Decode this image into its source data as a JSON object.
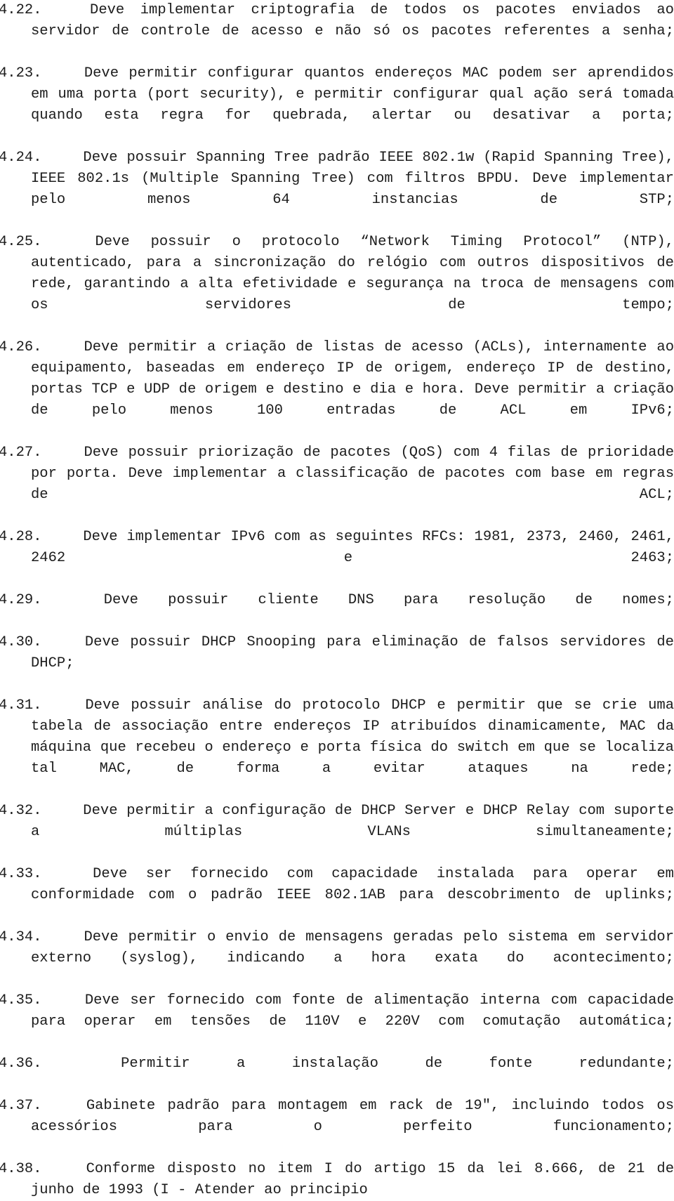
{
  "document": {
    "kind": "specification-list",
    "language": "pt-BR",
    "background_color": "#ffffff",
    "text_color": "#1c1c1c",
    "alignment": "justified",
    "items": [
      {
        "number": "4.22.",
        "text": "Deve implementar criptografia de todos os pacotes enviados ao servidor de controle de acesso e não só os pacotes referentes a senha;",
        "justify_last_line": false
      },
      {
        "number": "4.23.",
        "text": "Deve permitir configurar quantos endereços MAC podem ser aprendidos em uma porta (port security), e permitir configurar qual ação será tomada quando esta regra for quebrada, alertar ou desativar a porta;",
        "justify_last_line": false
      },
      {
        "number": "4.24.",
        "text": "Deve possuir Spanning Tree padrão IEEE 802.1w (Rapid Spanning Tree), IEEE 802.1s (Multiple Spanning Tree) com filtros BPDU. Deve implementar pelo menos 64 instancias de STP;",
        "justify_last_line": false
      },
      {
        "number": "4.25.",
        "text": "Deve possuir o protocolo “Network Timing Protocol” (NTP), autenticado, para a sincronização do relógio com outros dispositivos de rede, garantindo a alta efetividade e segurança na troca de mensagens com os servidores de tempo;",
        "justify_last_line": false
      },
      {
        "number": "4.26.",
        "text": "Deve permitir a criação de listas de acesso (ACLs), internamente ao equipamento, baseadas em endereço IP de origem, endereço IP de destino, portas TCP e UDP de origem e destino e dia e hora. Deve permitir a criação de pelo menos 100 entradas de ACL em IPv6;",
        "justify_last_line": false
      },
      {
        "number": "4.27.",
        "text": "Deve possuir priorização de pacotes (QoS) com 4 filas de prioridade por porta. Deve implementar a classificação de pacotes com base em regras de ACL;",
        "justify_last_line": false
      },
      {
        "number": "4.28.",
        "text": "Deve implementar IPv6 com as seguintes RFCs: 1981, 2373, 2460, 2461, 2462 e 2463;",
        "justify_last_line": false
      },
      {
        "number": "4.29.",
        "text": "Deve possuir cliente DNS para resolução de nomes;",
        "justify_last_line": false
      },
      {
        "number": "4.30.",
        "text": "Deve possuir DHCP Snooping para eliminação de falsos servidores de DHCP;",
        "justify_last_line": false
      },
      {
        "number": "4.31.",
        "text": "Deve possuir análise do protocolo DHCP e permitir que se crie uma tabela de associação entre endereços IP atribuídos dinamicamente, MAC da máquina que recebeu o endereço e porta física do switch em que se localiza tal MAC, de forma a evitar ataques na rede;",
        "justify_last_line": false
      },
      {
        "number": "4.32.",
        "text": "Deve permitir a configuração de DHCP Server e DHCP Relay com suporte a múltiplas VLANs simultaneamente;",
        "justify_last_line": false
      },
      {
        "number": "4.33.",
        "text": "Deve ser fornecido com capacidade instalada para operar em conformidade com o padrão IEEE 802.1AB para descobrimento de uplinks;",
        "justify_last_line": false
      },
      {
        "number": "4.34.",
        "text": "Deve permitir o envio de mensagens geradas pelo sistema em servidor externo (syslog), indicando a hora exata do acontecimento;",
        "justify_last_line": false
      },
      {
        "number": "4.35.",
        "text": "Deve ser fornecido com fonte de alimentação interna com capacidade para operar em tensões de 110V e 220V com comutação automática;",
        "justify_last_line": false
      },
      {
        "number": "4.36.",
        "text": "Permitir a instalação de fonte redundante;",
        "justify_last_line": false
      },
      {
        "number": "4.37.",
        "text": "Gabinete padrão para montagem em rack de 19\", incluindo todos os acessórios para o perfeito funcionamento;",
        "justify_last_line": false
      },
      {
        "number": "4.38.",
        "text": "Conforme disposto no item I do artigo 15 da lei 8.666, de 21 de junho de 1993 (I - Atender ao principio",
        "justify_last_line": true,
        "truncated_at_page_bottom": true
      }
    ]
  }
}
